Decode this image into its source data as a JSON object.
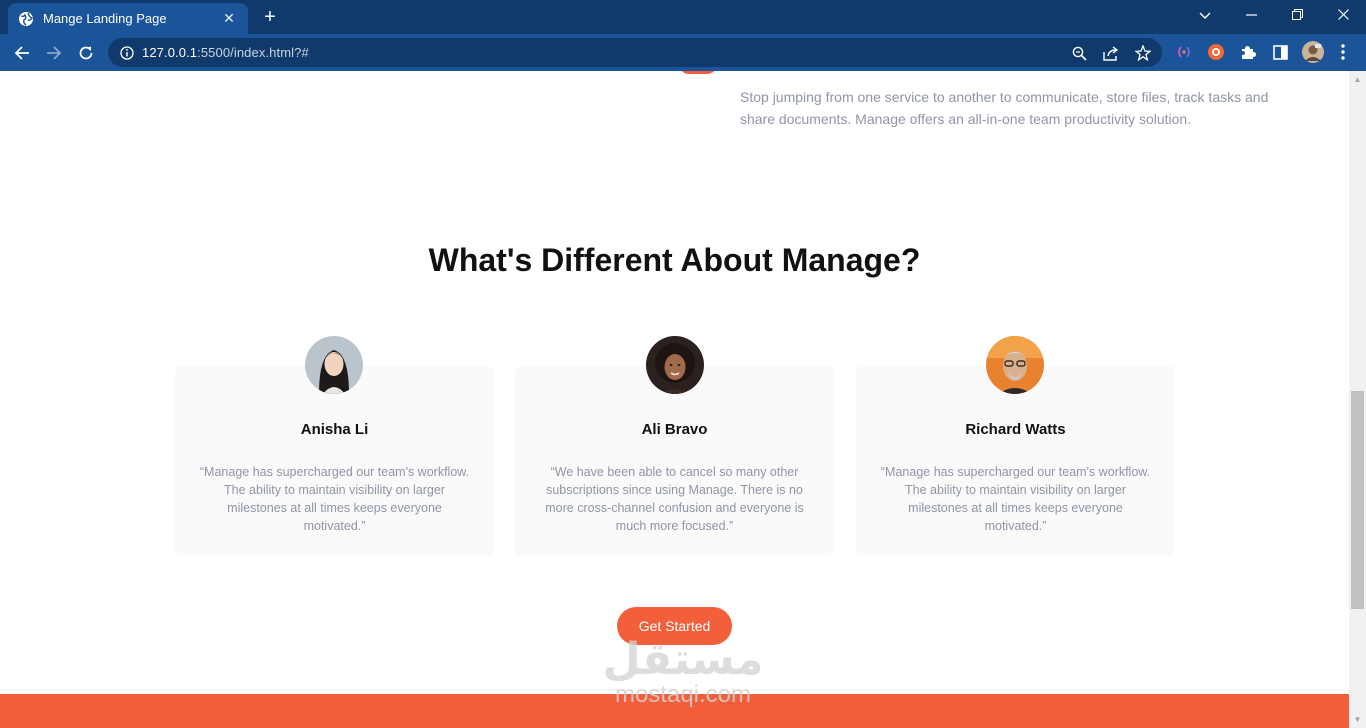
{
  "browser": {
    "tab": {
      "title": "Mange Landing Page",
      "close_glyph": "✕"
    },
    "new_tab_glyph": "+",
    "window_controls": {
      "dropdown": "⌄",
      "minimize": "—",
      "restore": "❐",
      "close": "✕"
    },
    "address": {
      "host": "127.0.0.1",
      "path": ":5500/index.html?#"
    },
    "icons": [
      "globe-icon",
      "back-icon",
      "forward-icon",
      "reload-icon",
      "info-icon",
      "zoom-icon",
      "share-icon",
      "bookmark-star-icon",
      "extension-icon",
      "puzzle-icon",
      "sidepanel-icon",
      "profile-avatar"
    ]
  },
  "page": {
    "feature_description": "Stop jumping from one service to another to communicate, store files, track tasks and share documents. Manage offers an all-in-one team productivity solution.",
    "section_title": "What's Different About Manage?",
    "testimonials": [
      {
        "name": "Anisha Li",
        "quote": "“Manage has supercharged our team's workflow. The ability to maintain visibility on larger milestones at all times keeps everyone motivated.”"
      },
      {
        "name": "Ali Bravo",
        "quote": "“We have been able to cancel so many other subscriptions since using Manage. There is no more cross-channel confusion and everyone is much more focused.”"
      },
      {
        "name": "Richard Watts",
        "quote": "“Manage has supercharged our team's workflow. The ability to maintain visibility on larger milestones at all times keeps everyone motivated.”"
      }
    ],
    "cta_label": "Get Started",
    "watermark": {
      "arabic": "مستقل",
      "latin": "mostaqi.com"
    }
  },
  "colors": {
    "chrome_dark": "#0f3a6b",
    "chrome_light": "#1b5498",
    "accent_orange": "#f25f3a",
    "heading": "#111111",
    "body_text": "#9095a7",
    "card_bg": "#fafafa"
  }
}
